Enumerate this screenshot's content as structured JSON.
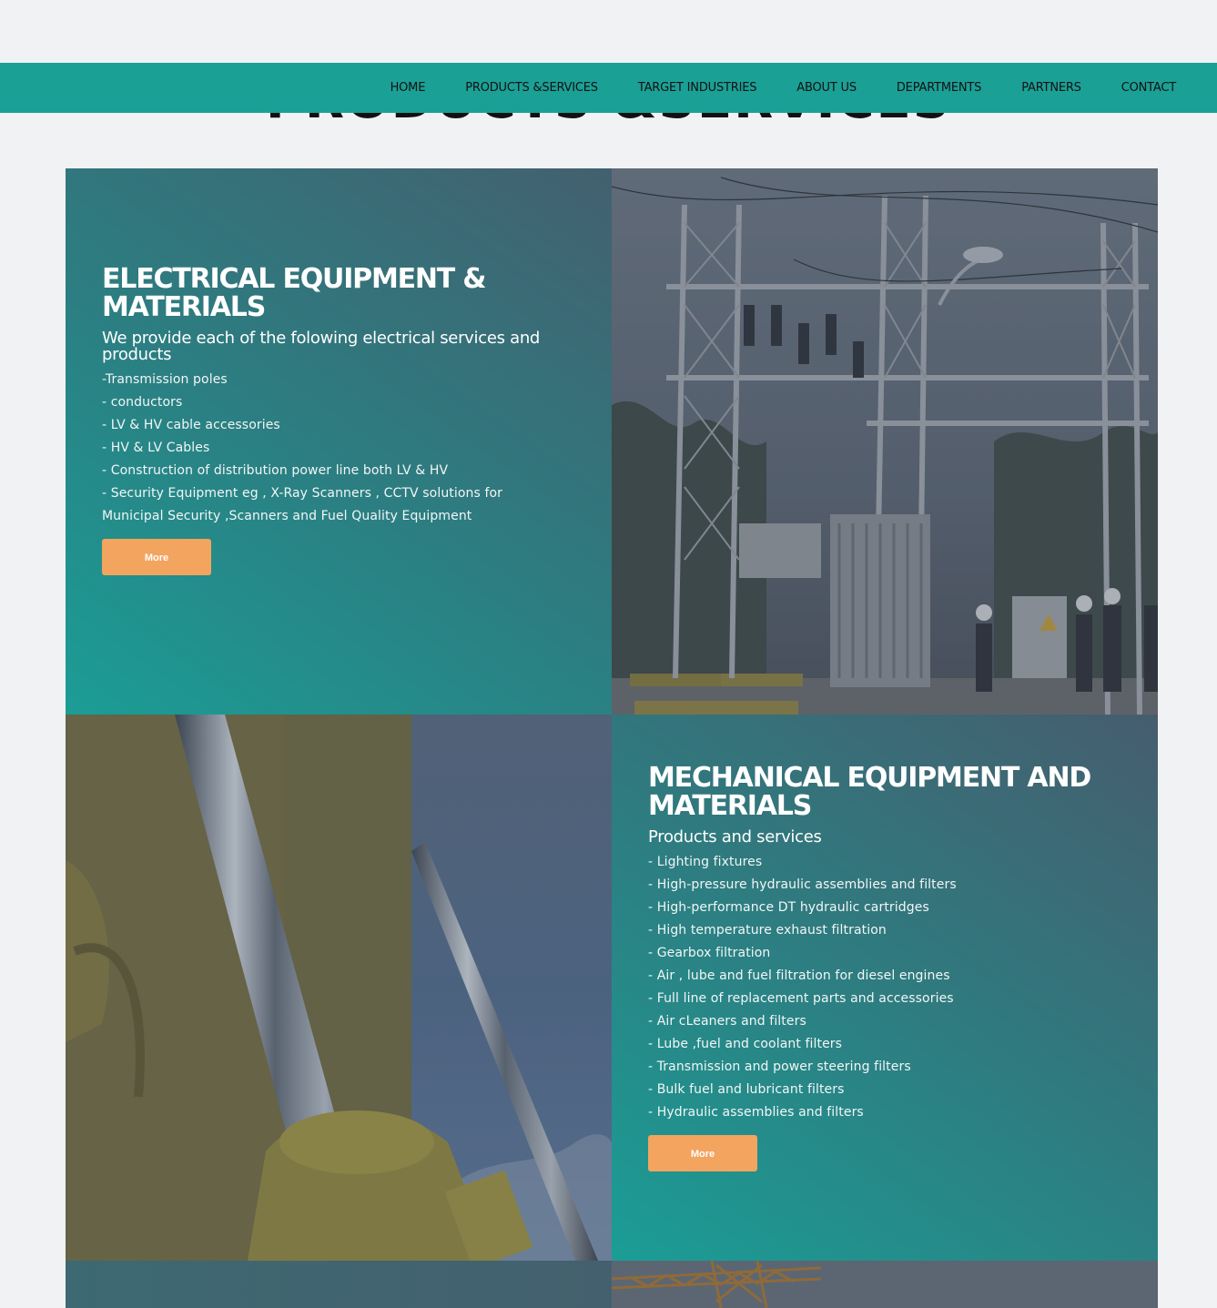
{
  "nav": {
    "items": [
      {
        "label": "HOME"
      },
      {
        "label": "PRODUCTS &SERVICES"
      },
      {
        "label": "TARGET INDUSTRIES"
      },
      {
        "label": "ABOUT US"
      },
      {
        "label": "DEPARTMENTS"
      },
      {
        "label": "PARTNERS"
      },
      {
        "label": "CONTACT"
      }
    ],
    "background": "#1ba096"
  },
  "section": {
    "title": "PRODUCTS &SERVICES"
  },
  "electrical": {
    "heading": "ELECTRICAL EQUIPMENT & MATERIALS",
    "subheading": "We provide each of the folowing electrical services and products",
    "items": [
      "-Transmission poles",
      "- conductors",
      "- LV & HV cable accessories",
      "- HV & LV Cables",
      "- Construction of distribution power line both LV & HV",
      "- Security Equipment eg , X-Ray Scanners , CCTV solutions for",
      "Municipal Security ,Scanners and Fuel Quality Equipment"
    ],
    "button_label": "More"
  },
  "mechanical": {
    "heading": "MECHANICAL EQUIPMENT AND MATERIALS",
    "subheading": "Products and services",
    "items": [
      "- Lighting fixtures",
      "- High-pressure hydraulic assemblies and filters",
      "- High-performance DT hydraulic cartridges",
      "- High temperature exhaust filtration",
      "- Gearbox filtration",
      "- Air , lube and fuel filtration for diesel engines",
      "- Full line of replacement parts and accessories",
      "- Air cLeaners and filters",
      "- Lube ,fuel and coolant filters",
      "- Transmission and power steering filters",
      "- Bulk fuel and lubricant filters",
      "- Hydraulic assemblies and filters"
    ],
    "button_label": "More"
  },
  "colors": {
    "accent_button": "#f3a45f",
    "panel_teal": "#1b9d95",
    "page_background": "#f1f2f4"
  }
}
